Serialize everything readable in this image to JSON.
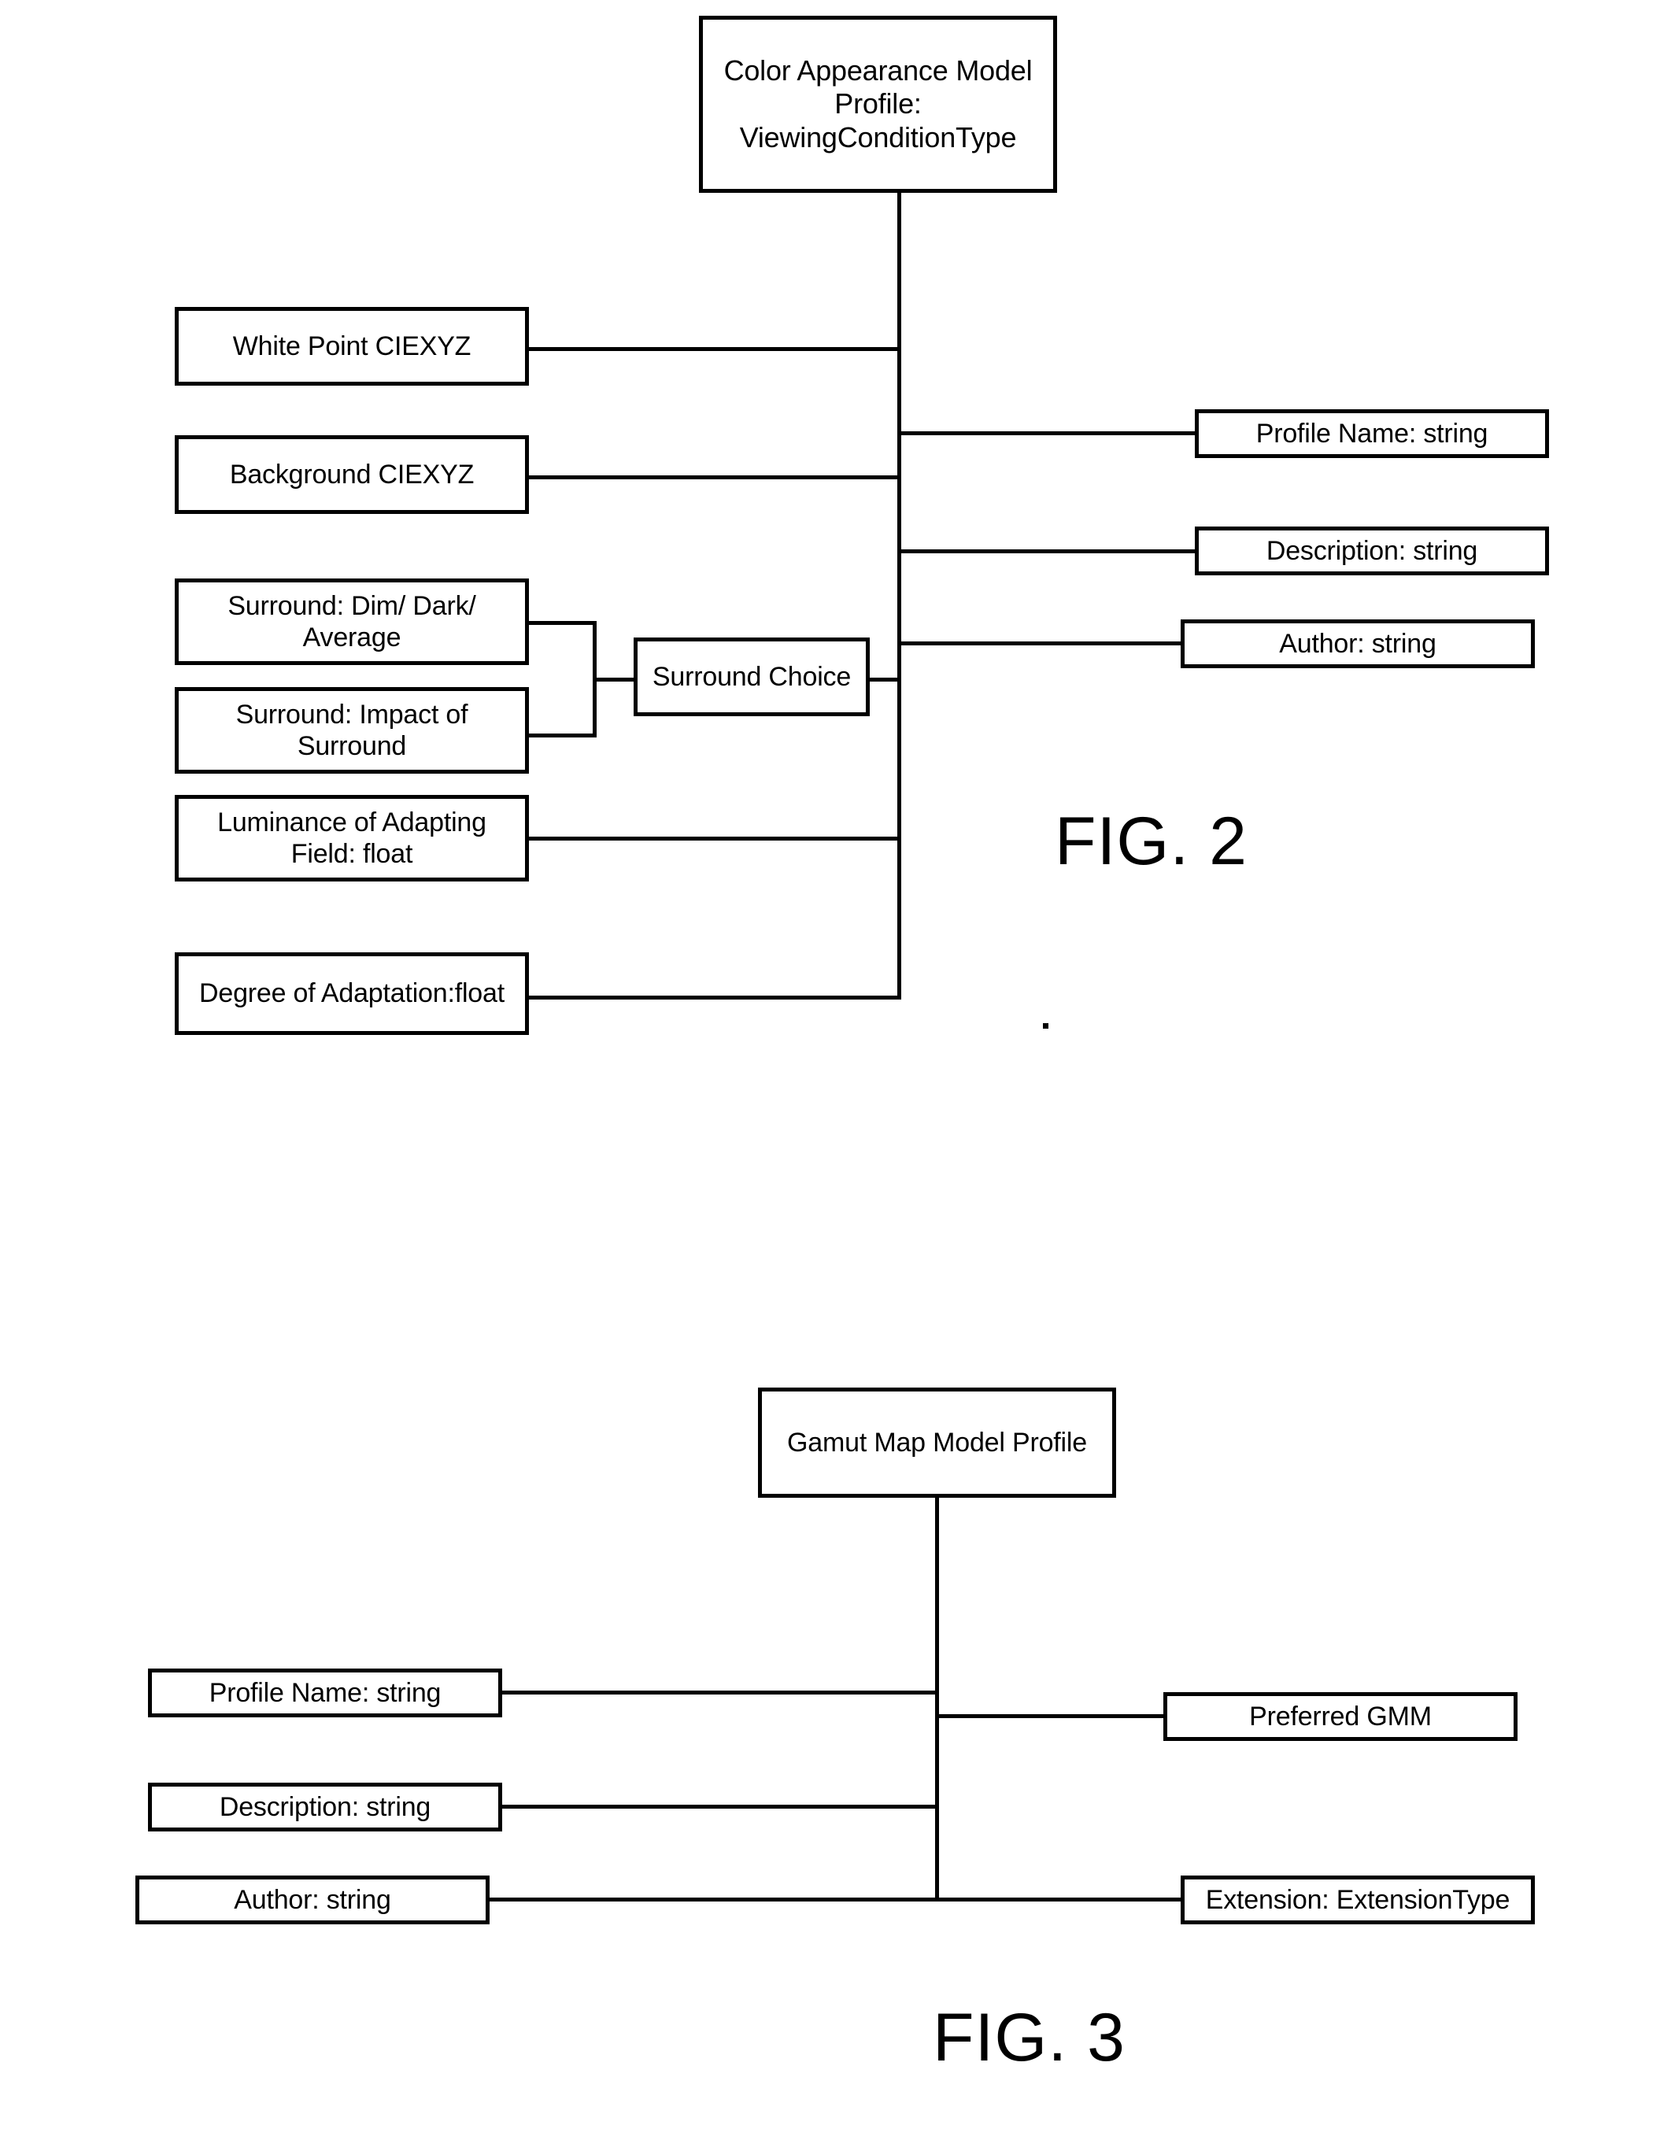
{
  "figures": [
    {
      "id": "fig2",
      "label": "FIG. 2",
      "root": "Color Appearance Model\nProfile:\nViewingConditionType",
      "left_nodes": [
        "White Point CIEXYZ",
        "Background CIEXYZ",
        "Surround: Dim/ Dark/\nAverage",
        "Surround:  Impact of\nSurround",
        "Luminance of Adapting\nField: float",
        "Degree of Adaptation:float"
      ],
      "mid_node": "Surround Choice",
      "right_nodes": [
        "Profile Name: string",
        "Description: string",
        "Author: string"
      ]
    },
    {
      "id": "fig3",
      "label": "FIG. 3",
      "root": "Gamut Map Model Profile",
      "left_nodes": [
        "Profile Name: string",
        "Description: string",
        "Author: string"
      ],
      "right_nodes": [
        "Preferred GMM",
        "Extension:  ExtensionType"
      ]
    }
  ]
}
